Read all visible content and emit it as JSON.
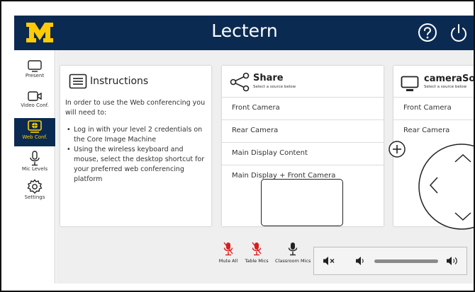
{
  "header": {
    "logo_text": "M",
    "title": "Lectern",
    "help_icon": "help-circle-icon",
    "power_icon": "power-icon",
    "background": "#0b2a52",
    "logo_color": "#ffcb05"
  },
  "sidebar": {
    "items": [
      {
        "label": "Present",
        "icon": "monitor-icon",
        "active": false
      },
      {
        "label": "Video Conf.",
        "icon": "video-camera-icon",
        "active": false
      },
      {
        "label": "Web Conf.",
        "icon": "web-conference-icon",
        "active": true
      },
      {
        "label": "Mic Levels",
        "icon": "microphone-icon",
        "active": false
      },
      {
        "label": "Settings",
        "icon": "gear-icon",
        "active": false
      }
    ]
  },
  "instructions": {
    "title": "Instructions",
    "icon": "document-lines-icon",
    "intro": "In order to use the Web conferencing you will need to:",
    "steps": [
      "Log in with your level 2 credentials on the Core Image Machine",
      "Using the wireless keyboard and mouse, select the desktop shortcut for your preferred web conferencing platform"
    ]
  },
  "share": {
    "title": "Share",
    "subtitle": "Select a source below",
    "icon": "share-icon",
    "sources": [
      "Front Camera",
      "Rear Camera",
      "Main Display Content",
      "Main Display + Front Camera"
    ]
  },
  "camera_source": {
    "title": "cameraSou",
    "subtitle": "Select a source below",
    "icon": "monitor-icon",
    "sources": [
      "Front Camera",
      "Rear Camera"
    ]
  },
  "audio": {
    "mute_all_label": "Mute All",
    "table_mics_label": "Table Mics",
    "classroom_mics_label": "Classroom Mics",
    "muted_color": "#d81e1e",
    "volume_icons": [
      "volume-mute-icon",
      "volume-low-icon",
      "volume-high-icon"
    ],
    "volume_level": 0.78
  }
}
